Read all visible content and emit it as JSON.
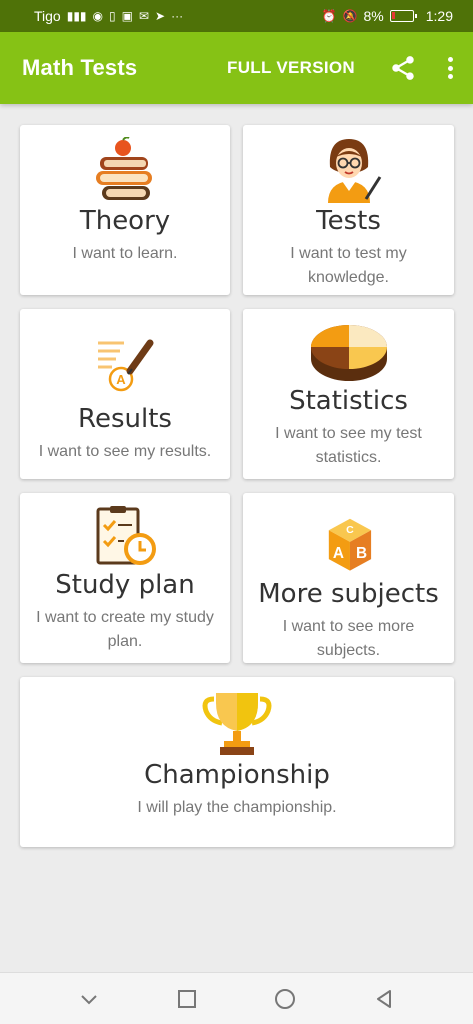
{
  "status_bar": {
    "carrier": "Tigo",
    "left_icons": [
      "signal-icon",
      "whatsapp-icon",
      "sim-icon",
      "image-icon",
      "mail-icon",
      "telegram-icon",
      "more-notifications-icon"
    ],
    "battery_percent": "8%",
    "time": "1:29",
    "right_icons": [
      "alarm-icon",
      "mute-icon",
      "battery-icon"
    ]
  },
  "app_bar": {
    "title": "Math Tests",
    "full_version_label": "FULL VERSION",
    "share_icon": "share-icon",
    "menu_icon": "overflow-menu-icon"
  },
  "menu": [
    {
      "key": "theory",
      "title": "Theory",
      "subtitle": "I want to learn.",
      "icon": "books-apple-icon"
    },
    {
      "key": "tests",
      "title": "Tests",
      "subtitle": "I want to test my knowledge.",
      "icon": "teacher-icon"
    },
    {
      "key": "results",
      "title": "Results",
      "subtitle": "I want to see my results.",
      "icon": "graded-paper-icon"
    },
    {
      "key": "statistics",
      "title": "Statistics",
      "subtitle": "I want to see my test statistics.",
      "icon": "pie-chart-icon"
    },
    {
      "key": "study-plan",
      "title": "Study plan",
      "subtitle": "I want to create my study plan.",
      "icon": "checklist-clock-icon"
    },
    {
      "key": "more-subjects",
      "title": "More subjects",
      "subtitle": "I want to see more subjects.",
      "icon": "abc-blocks-icon"
    },
    {
      "key": "championship",
      "title": "Championship",
      "subtitle": "I will play the championship.",
      "icon": "trophy-icon"
    }
  ],
  "nav_bar": [
    "back-down-icon",
    "recents-icon",
    "home-icon",
    "back-icon"
  ],
  "colors": {
    "status_bar": "#4f7208",
    "app_bar": "#86c215",
    "background": "#ececec",
    "accent_orange": "#f39c12"
  }
}
